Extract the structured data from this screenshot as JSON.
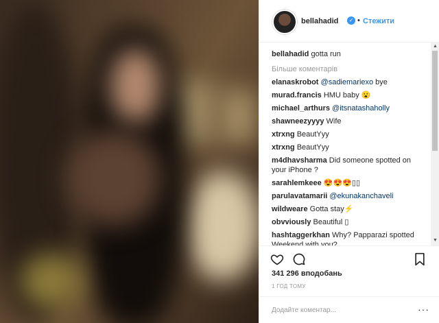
{
  "post": {
    "username": "bellahadid",
    "follow_label": "Стежити",
    "caption_user": "bellahadid",
    "caption_text": "gotta run",
    "more_comments_label": "Більше коментарів",
    "likes": "341 296 вподобань",
    "time": "1 ГОД ТОМУ",
    "comment_placeholder": "Додайте коментар..."
  },
  "comments": [
    {
      "user": "elanaskrobot",
      "mention": "@sadiemariexo",
      "text": " bye"
    },
    {
      "user": "murad.francis",
      "mention": "",
      "text": "HMU baby 😮"
    },
    {
      "user": "michael_arthurs",
      "mention": "@itsnatashaholly",
      "text": ""
    },
    {
      "user": "shawneezyyyy",
      "mention": "",
      "text": "Wife"
    },
    {
      "user": "xtrxng",
      "mention": "",
      "text": "BeautYyy"
    },
    {
      "user": "xtrxng",
      "mention": "",
      "text": "BeautYyy"
    },
    {
      "user": "m4dhavsharma",
      "mention": "",
      "text": "Did someone spotted on your iPhone ?"
    },
    {
      "user": "sarahlemkeee",
      "mention": "",
      "text": "😍😍😍▯▯"
    },
    {
      "user": "parulavatamarii",
      "mention": "@ekunakanchaveli",
      "text": ""
    },
    {
      "user": "wildweare",
      "mention": "",
      "text": "Gotta stay⚡"
    },
    {
      "user": "obvviously",
      "mention": "",
      "text": "Beautiful ▯"
    },
    {
      "user": "hashtaggerkhan",
      "mention": "",
      "text": "Why? Papparazi spotted Weekend with you?"
    }
  ],
  "icons": {
    "heart": "heart-icon",
    "comment": "comment-icon",
    "bookmark": "bookmark-icon",
    "verified": "verified-badge-icon",
    "more": "more-options-icon"
  },
  "colors": {
    "link": "#3897f0",
    "mention": "#003569",
    "muted": "#999999"
  }
}
